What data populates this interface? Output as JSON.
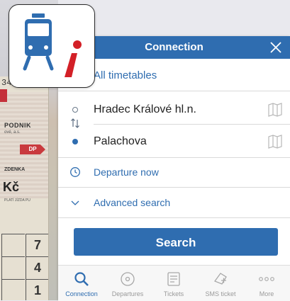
{
  "background_ticket": {
    "number_fragment": "34",
    "podnik": "PODNIK",
    "podnik_sub": "ové, a.s.",
    "dp": "DP",
    "zdenka": "ZDENKA",
    "kc": "Kč",
    "plati": "PLATÍ JÍZDA PU",
    "grid_numbers": [
      "7",
      "4",
      "1"
    ]
  },
  "colors": {
    "accent": "#2f6db0",
    "brand_red": "#d32027",
    "tab_inactive": "#9a9a9a"
  },
  "dialog": {
    "title": "Connection",
    "close_icon": "close-icon",
    "all_timetables": "All timetables",
    "from": "Hradec Králové hl.n.",
    "to": "Palachova",
    "departure": "Departure now",
    "advanced": "Advanced search",
    "search_label": "Search"
  },
  "tabs": [
    {
      "label": "Connection",
      "icon": "search-icon",
      "active": true
    },
    {
      "label": "Departures",
      "icon": "departures-icon",
      "active": false
    },
    {
      "label": "Tickets",
      "icon": "ticket-icon",
      "active": false
    },
    {
      "label": "SMS ticket",
      "icon": "sms-ticket-icon",
      "active": false
    },
    {
      "label": "More",
      "icon": "more-icon",
      "active": false
    }
  ]
}
